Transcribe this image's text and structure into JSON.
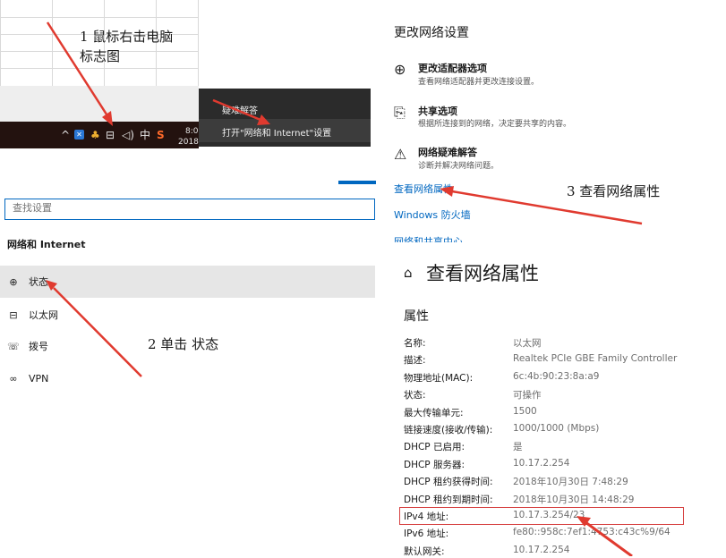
{
  "annotations": {
    "step1_line1": "1 鼠标右击电脑",
    "step1_line2": "标志图",
    "step2": "2 单击 状态",
    "step3": "3 查看网络属性"
  },
  "taskbar": {
    "time": "8:0",
    "date": "2018",
    "ime": "中"
  },
  "context_menu": {
    "item1": "疑难解答",
    "item2": "打开\"网络和 Internet\"设置"
  },
  "settings_left": {
    "search_placeholder": "查找设置",
    "section_title": "网络和 Internet",
    "nav": [
      {
        "label": "状态",
        "icon": "globe-icon"
      },
      {
        "label": "以太网",
        "icon": "ethernet-icon"
      },
      {
        "label": "拨号",
        "icon": "dialup-icon"
      },
      {
        "label": "VPN",
        "icon": "vpn-icon"
      }
    ]
  },
  "network_settings": {
    "heading": "更改网络设置",
    "options": [
      {
        "title": "更改适配器选项",
        "desc": "查看网络适配器并更改连接设置。",
        "icon": "adapter-globe-icon"
      },
      {
        "title": "共享选项",
        "desc": "根据所连接到的网络，决定要共享的内容。",
        "icon": "sharing-icon"
      },
      {
        "title": "网络疑难解答",
        "desc": "诊断并解决网络问题。",
        "icon": "warning-icon"
      }
    ],
    "links": [
      "查看网络属性",
      "Windows 防火墙",
      "网络和共享中心"
    ]
  },
  "properties": {
    "page_title": "查看网络属性",
    "section": "属性",
    "rows": [
      {
        "label": "名称:",
        "value": "以太网"
      },
      {
        "label": "描述:",
        "value": "Realtek PCIe GBE Family Controller"
      },
      {
        "label": "物理地址(MAC):",
        "value": "6c:4b:90:23:8a:a9"
      },
      {
        "label": "状态:",
        "value": "可操作"
      },
      {
        "label": "最大传输单元:",
        "value": "1500"
      },
      {
        "label": "链接速度(接收/传输):",
        "value": "1000/1000 (Mbps)"
      },
      {
        "label": "DHCP 已启用:",
        "value": "是"
      },
      {
        "label": "DHCP 服务器:",
        "value": "10.17.2.254"
      },
      {
        "label": "DHCP 租约获得时间:",
        "value": "2018年10月30日 7:48:29"
      },
      {
        "label": "DHCP 租约到期时间:",
        "value": "2018年10月30日 14:48:29"
      },
      {
        "label": "IPv4 地址:",
        "value": "10.17.3.254/23"
      },
      {
        "label": "IPv6 地址:",
        "value": "fe80::958c:7ef1:4753:c43c%9/64"
      },
      {
        "label": "默认网关:",
        "value": "10.17.2.254"
      }
    ]
  },
  "colors": {
    "accent": "#0067c0",
    "arrow": "#e03a2f",
    "highlight_box": "#d64040"
  }
}
